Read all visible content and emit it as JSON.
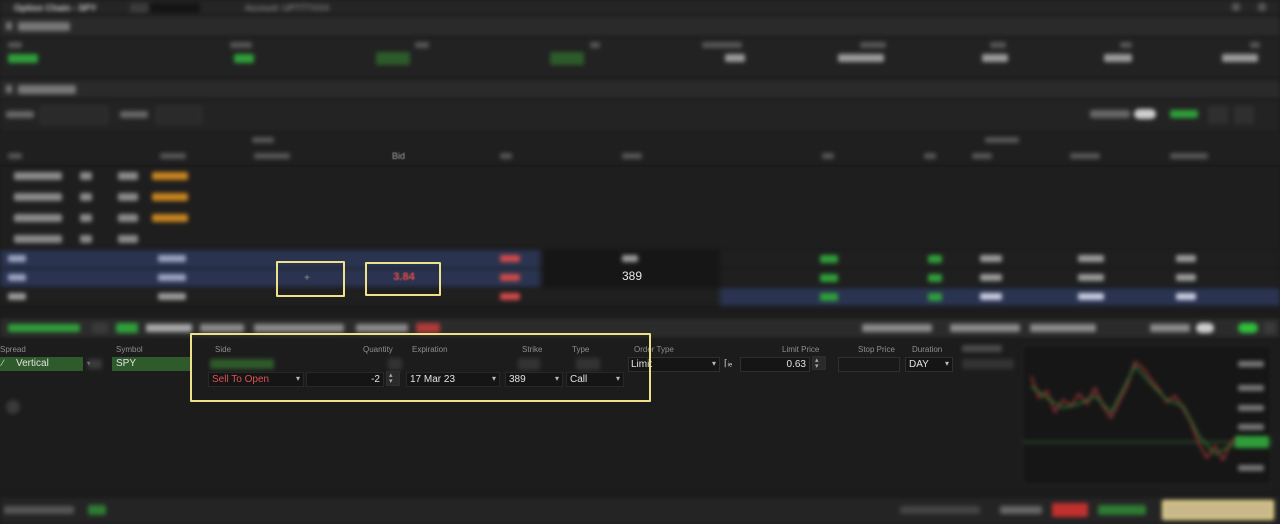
{
  "app": {
    "title": "Option Chain - SPY",
    "account": "Account: UPTTTXXX"
  },
  "chain": {
    "bid_header": "Bid",
    "highlighted_bid": "3.84",
    "center_strike": "389",
    "plus_symbol": "+"
  },
  "order": {
    "labels": {
      "spread": "Spread",
      "symbol": "Symbol",
      "side": "Side",
      "quantity": "Quantity",
      "expiration": "Expiration",
      "strike": "Strike",
      "type": "Type",
      "order_type": "Order Type",
      "limit_price": "Limit Price",
      "stop_price": "Stop Price",
      "duration": "Duration"
    },
    "spread_value": "Vertical",
    "symbol_value": "SPY",
    "side_value": "Sell To Open",
    "quantity_value": "-2",
    "expiration_value": "17 Mar 23",
    "strike_value": "389",
    "type_value": "Call",
    "order_type_value": "Limit",
    "limit_price_value": "0.63",
    "duration_value": "DAY"
  },
  "colors": {
    "accent_green": "#2f5a2b",
    "bid_red": "#e64a4a",
    "highlight": "#efe08a"
  }
}
